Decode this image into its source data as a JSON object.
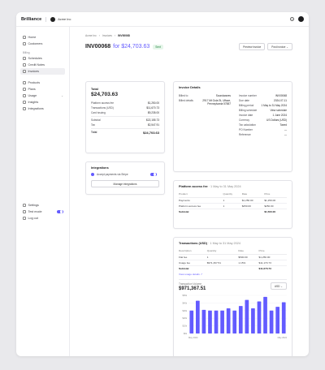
{
  "header": {
    "brand": "Brilliance",
    "org": "Acme Inc"
  },
  "sidebar": {
    "top": [
      {
        "label": "Home",
        "icon": "home-icon"
      },
      {
        "label": "Customers",
        "icon": "users-icon"
      }
    ],
    "billing_label": "Billing",
    "billing": [
      {
        "label": "Schedules",
        "icon": "calendar-icon"
      },
      {
        "label": "Credit Notes",
        "icon": "document-icon"
      },
      {
        "label": "Invoices",
        "icon": "invoice-icon",
        "active": true
      }
    ],
    "catalog": [
      {
        "label": "Products",
        "icon": "box-icon"
      },
      {
        "label": "Plans",
        "icon": "layers-icon"
      },
      {
        "label": "Usage",
        "icon": "meter-icon",
        "chevron": true
      },
      {
        "label": "Insights",
        "icon": "chart-icon"
      },
      {
        "label": "Integrations",
        "icon": "plug-icon"
      }
    ],
    "bottom": [
      {
        "label": "Settings",
        "icon": "gear-icon"
      },
      {
        "label": "Test mode",
        "icon": "flask-icon",
        "toggle": true,
        "value": true
      },
      {
        "label": "Log out",
        "icon": "logout-icon"
      }
    ]
  },
  "breadcrumb": [
    "Acme Inc",
    "Invoices",
    "INV00068"
  ],
  "page": {
    "invoice_id": "INV00068",
    "for_label": "for $24,703.63",
    "status": "Sent",
    "preview_button": "Preview invoice",
    "post_button": "Post invoice"
  },
  "total_card": {
    "label": "Total",
    "amount": "$24,703.63",
    "lines": [
      {
        "label": "Platform access fee",
        "value": "$1,250.00"
      },
      {
        "label": "Transactions (USD)",
        "value": "$11,670.73"
      },
      {
        "label": "Card issuing",
        "value": "$9,235.00"
      }
    ],
    "subtotal_label": "Subtotal",
    "subtotal": "$22,155.73",
    "tax_label": "Tax",
    "tax": "$2,547.91",
    "total_label": "Total",
    "total": "$24,703.63"
  },
  "integrations": {
    "title": "Integrations",
    "stripe_label": "Accept payments via Stripe",
    "stripe_enabled": true,
    "manage_button": "Manage integrations"
  },
  "details": {
    "title": "Invoice Details",
    "billed_to_label": "Billed to",
    "billed_to": "Soundwaves",
    "billed_details_label": "Billed details",
    "billed_details_line1": "2917 Mt Gola St, Ulface,",
    "billed_details_line2": "Pennsylvania 57887",
    "right": [
      {
        "label": "Invoice number",
        "value": "INV00068"
      },
      {
        "label": "Due date",
        "value": "2024-07-11"
      },
      {
        "label": "Billing period",
        "value": "1 May to 31 May 2024"
      },
      {
        "label": "Billing schedule",
        "value": "View schedule",
        "link": true
      },
      {
        "label": "Invoice date",
        "value": "1 June 2024"
      },
      {
        "label": "Currency",
        "value": "US Dollars (USD)"
      },
      {
        "label": "Tax calculation",
        "value": "Taxed"
      },
      {
        "label": "PO Number",
        "value": "—"
      },
      {
        "label": "Reference",
        "value": "—"
      }
    ]
  },
  "platform": {
    "title": "Platform access fee",
    "period": "· 1 May to 31 May 2024",
    "columns": [
      "Product",
      "Quantity",
      "Rate",
      "Price"
    ],
    "rows": [
      [
        "Payments",
        "1",
        "$1,250.00",
        "$1,250.00"
      ],
      [
        "Platform access fee",
        "1",
        "$250.00",
        "$250.00"
      ]
    ],
    "subtotal_label": "Subtotal",
    "subtotal": "$1,500.00"
  },
  "transactions": {
    "title": "Transactions (USD)",
    "period": "· 1 May to 31 May 2024",
    "columns": [
      "Description",
      "Quantity",
      "Rate",
      "Price"
    ],
    "rows": [
      [
        "Flat fee",
        "1",
        "$500.00",
        "$1,250.00"
      ],
      [
        "Usage fee",
        "$971,367.51",
        "1.15%",
        "$11,170.73"
      ]
    ],
    "subtotal_label": "Subtotal",
    "subtotal": "$11,670.73",
    "view_usage": "View usage details ↗"
  },
  "volume": {
    "label": "Transaction Volume",
    "amount": "$971,367.51",
    "currency": "USD",
    "bar_color": "#635bff"
  },
  "chart_data": {
    "type": "bar",
    "title": "",
    "xlabel": "",
    "ylabel": "",
    "x_tick_labels": [
      "May 2024",
      "May 2024"
    ],
    "y_tick_labels": [
      "$50k",
      "$40k",
      "$30k",
      "$20k",
      "$10k",
      "$0k"
    ],
    "values": [
      30,
      43,
      31,
      30,
      30,
      30,
      33,
      30,
      36,
      44,
      33,
      42,
      48,
      30,
      35,
      41
    ],
    "ylim": [
      0,
      50
    ]
  }
}
